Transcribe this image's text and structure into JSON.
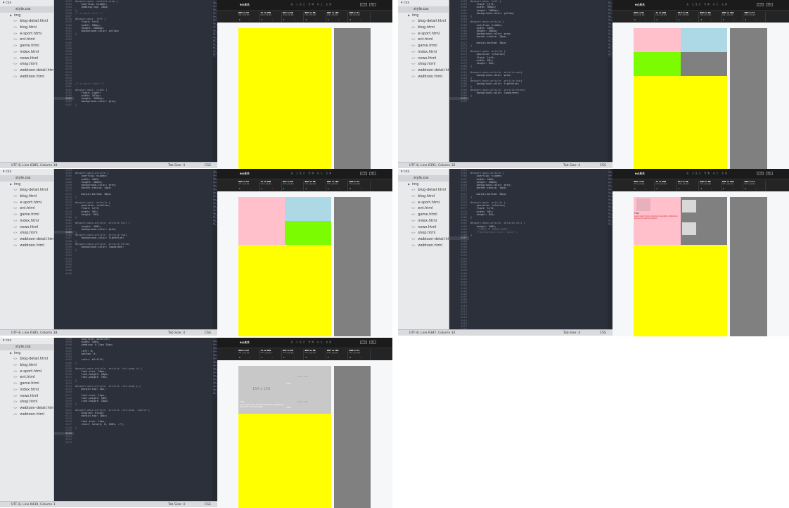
{
  "sidebar_files": [
    "blog-detail.html",
    "blog.html",
    "e-sport.html",
    "ent.html",
    "game.html",
    "index.html",
    "news.html",
    "shop.html",
    "webtoon-detail.html",
    "webtoon.html"
  ],
  "sidebar_style": "style.css",
  "sidebar_img": "img",
  "sidebar_css": "css",
  "colors": {
    "yellow": "#ffff00",
    "grey": "#808080",
    "pink": "#ffc0cb",
    "lightblue": "#add8e6",
    "lawngreen": "#7cfc00",
    "editor_bg": "#2b303b",
    "thumb": "#c8c8c8"
  },
  "panels": [
    {
      "status": "UTF-8, Line 6385, Column 18",
      "tabsize": "Tab Size: 4",
      "syntax": "CSS",
      "lines": [
        "6352",
        "6353",
        "6354",
        "6355",
        "6356",
        "6357",
        "6358",
        "6359",
        "6360",
        "6361",
        "6362",
        "6363",
        "6364",
        "6365",
        "6366",
        "6367",
        "6368",
        "6369",
        "6370",
        "6371",
        "6372",
        "6373",
        "6374",
        "6375",
        "6376",
        "6377",
        "6378",
        "6379",
        "6380",
        "6381",
        "6382",
        "6383",
        "6384",
        "6385",
        "6386",
        "6387"
      ],
      "code": [
        "#esport-main .content-wrap {",
        "    overflow: hidden;",
        "    padding-top: 30px;",
        "}",
        "/* e-sport left */",
        "",
        "#esport-main .left {",
        "    float: left;",
        "    width: 900px;",
        "    height: 2000px;",
        "    background-color: yellow;",
        "}",
        "",
        "",
        "",
        "",
        "",
        "",
        "",
        "",
        "",
        "",
        "",
        "",
        "",
        "",
        "",
        "",
        "/* e-sport right */",
        "",
        "#esport-main .right {",
        "    float: right;",
        "    width: 357px;",
        "    height: 2000px;",
        "    background-color: grey;",
        "}"
      ]
    },
    {
      "status": "UTF-8, Line 6391, Column 32",
      "tabsize": "Tab Size: 4",
      "syntax": "CSS",
      "lines": [
        "6358",
        "6359",
        "6360",
        "6361",
        "6362",
        "6363",
        "6364",
        "6365",
        "6366",
        "6367",
        "6368",
        "6369",
        "6370",
        "6371",
        "6372",
        "6373",
        "6374",
        "6375",
        "6376",
        "6377",
        "6378",
        "6379",
        "6380",
        "6381",
        "6382",
        "6383",
        "6384",
        "6385",
        "6386",
        "6387",
        "6388",
        "6389",
        "6390",
        "6391",
        "6392"
      ],
      "code": [
        "#esport-main .left {",
        "    float: left;",
        "    width: 900px;",
        "    height: 2000px;",
        "    background-color: yellow;",
        "}",
        "",
        "#esport-main-article {",
        "    overflow: hidden;",
        "    width: 100%;",
        "    height: 460px;",
        "    background-color: grey;",
        "    border-radius: 10px;",
        "",
        "    margin-bottom: 30px;",
        "}",
        "",
        "#esport-main .article {",
        "    position: relative;",
        "    float: left;",
        "    width: 50%;",
        "    height: 50%;",
        "}",
        "",
        "#esport-main-article .article.one{",
        "    background-color: pink;",
        "}",
        "#esport-main-article .article.two{",
        "    background-color: lightblue;",
        "}",
        "#esport-main-article .article.three{",
        "    background-color: lawngreen;",
        "}",
        "",
        ""
      ]
    },
    {
      "status": "UTF-8, Line 6385, Column 18",
      "tabsize": "Tab Size: 4",
      "syntax": "CSS",
      "lines": [
        "6364",
        "6365",
        "6366",
        "6367",
        "6368",
        "6369",
        "6370",
        "6371",
        "6372",
        "6373",
        "6374",
        "6375",
        "6376",
        "6377",
        "6378",
        "6379",
        "6380",
        "6381",
        "6382",
        "6383",
        "6384",
        "6385",
        "6386",
        "6387",
        "6388",
        "6389",
        "6390",
        "6391",
        "6392",
        "6393",
        "6394",
        "6395",
        "6396",
        "6397",
        "6398",
        "6399"
      ],
      "code": [
        "",
        "#esport-main-article {",
        "    overflow: hidden;",
        "    width: 100%;",
        "    height: 460px;",
        "    background-color: grey;",
        "    border-radius: 10px;",
        "",
        "    margin-bottom: 30px;",
        "}",
        "",
        "#esport-main .article {",
        "    position: relative;",
        "    float: left;",
        "    width: 50%;",
        "    height: 50%;",
        "}",
        "",
        "#esport-main-article .article.full {",
        "    height: 100%;",
        "    background-color: pink;",
        "}",
        "#esport-main-article .article.two{",
        "    background-color: lightblue;",
        "}",
        "#esport-main-article .article.three{",
        "    background-color: lawngreen;",
        "}",
        "",
        "",
        "",
        "",
        "",
        "",
        "",
        ""
      ]
    },
    {
      "status": "UTF-8, Line 6387, Column 32",
      "tabsize": "Tab Size: 4",
      "syntax": "CSS",
      "lines": [
        "6364",
        "6365",
        "6366",
        "6367",
        "6368",
        "6369",
        "6370",
        "6371",
        "6372",
        "6373",
        "6374",
        "6375",
        "6376",
        "6377",
        "6378",
        "6379",
        "6380",
        "6381",
        "6382",
        "6383",
        "6384",
        "6385",
        "6386",
        "6387",
        "6388",
        "6389",
        "6390",
        "6391",
        "6392",
        "6393",
        "6394",
        "6395",
        "6396",
        "6397",
        "6398",
        "6399",
        "6400",
        "6401",
        "6402",
        "6403",
        "6404",
        "6405",
        "6406",
        "6407",
        "6408",
        "6409",
        "6410",
        "6411",
        "6412",
        "6413",
        "6414",
        "6415",
        "6416",
        "6417",
        "6418"
      ],
      "code": [
        "",
        "#esport-main-article {",
        "    overflow: hidden;",
        "    width: 100%;",
        "    height: 460px;",
        "    background-color: grey;",
        "    border-radius: 10px;",
        "",
        "    margin-bottom: 30px;",
        "}",
        "",
        "#esport-main .article {",
        "    position: relative;",
        "    float: left;",
        "    width: 50%;",
        "    height: 50%;",
        "}",
        "",
        "#esport-main-article .article.full {",
        "    height: 100%;",
        "    /*이쪽만 꽉 채워주기위해*/",
        "    /*background-color: pink;*/",
        "}"
      ]
    },
    {
      "status": "UTF-8, Line 6430, Column 1",
      "tabsize": "Tab Size: 4",
      "syntax": "CSS",
      "lines": [
        "6398",
        "6399",
        "6400",
        "6401",
        "6402",
        "6403",
        "6404",
        "6405",
        "6406",
        "6407",
        "6408",
        "6409",
        "6410",
        "6411",
        "6412",
        "6413",
        "6414",
        "6415",
        "6416",
        "6417",
        "6418",
        "6419",
        "6420",
        "6421",
        "6422",
        "6423",
        "6424",
        "6425",
        "6426",
        "6427",
        "6428",
        "6429",
        "6430",
        "6431",
        "6432",
        "6433"
      ],
      "code": [
        "    position: absolute;",
        "    width: 100%;",
        "    padding: 0 24px 20px;",
        "",
        "    left: 0;",
        "    bottom: 0;",
        "",
        "    color: #ffffff;",
        "}",
        "",
        "#esport-main-article .article .txt-wrap h1 {",
        "    font-size: 20px;",
        "    line-height: 20px;",
        "    font-weight: 700;",
        "}",
        "",
        "#esport-main-article .article .txt-wrap p {",
        "    margin-top: 5px;",
        "",
        "    font-size: 14px;",
        "    font-weight: 500;",
        "    line-height: 18px;",
        "}",
        "",
        "#esport-main-article .article .txt-wrap .source {",
        "    display: block;",
        "    margin-top: 10px;",
        "",
        "    font-size: 13px;",
        "    color: hsla(0, 0, 100%, .7);",
        "}",
        "",
        "",
        "",
        "",
        ""
      ]
    }
  ],
  "preview": {
    "logo": "e스포츠",
    "menu": "홈  스포츠  연예  뉴스  쇼핑",
    "btn1": "로그인",
    "btn2": "메뉴",
    "scores": [
      {
        "t": "DRX vs KT",
        "s": "LCK 스프링 결승",
        "a": "0",
        "b": "3"
      },
      {
        "t": "T1 vs GEN",
        "s": "LCK 스프링 결승",
        "a": "2",
        "b": "1"
      },
      {
        "t": "HLE vs DK",
        "s": "LCK 스프링 결승",
        "a": "1",
        "b": "2"
      },
      {
        "t": "BRO vs NS",
        "s": "LCK 스프링 결승",
        "a": "3",
        "b": "0"
      },
      {
        "t": "KDF vs LSB",
        "s": "LCK 스프링 결승",
        "a": "2",
        "b": "2"
      },
      {
        "t": "DRX vs T1",
        "s": "LCK 스프링 결승",
        "a": "0",
        "b": "2"
      }
    ],
    "thumb_label": "150 x 150",
    "txt_title": "Title",
    "txt_body": "Lorem ipsum dolor sit amet consectetur adipisicing elit sed do eiusmod tempor",
    "txt_source": "source"
  }
}
